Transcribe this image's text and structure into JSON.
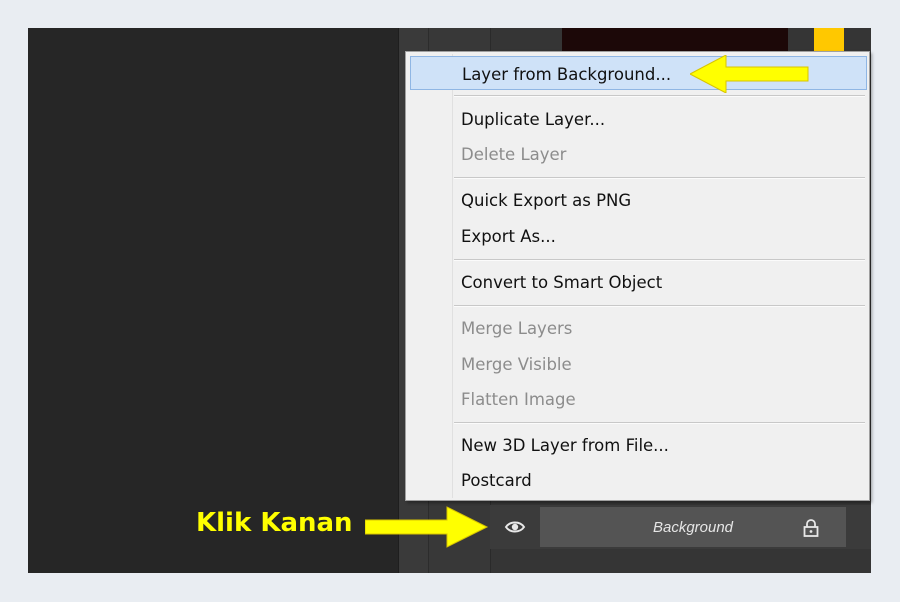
{
  "context_menu": {
    "items": [
      {
        "label": "Layer from Background...",
        "enabled": true,
        "highlighted": true
      },
      {
        "label": "Duplicate Layer...",
        "enabled": true
      },
      {
        "label": "Delete Layer",
        "enabled": false
      },
      {
        "label": "Quick Export as PNG",
        "enabled": true
      },
      {
        "label": "Export As...",
        "enabled": true
      },
      {
        "label": "Convert to Smart Object",
        "enabled": true
      },
      {
        "label": "Merge Layers",
        "enabled": false
      },
      {
        "label": "Merge Visible",
        "enabled": false
      },
      {
        "label": "Flatten Image",
        "enabled": false
      },
      {
        "label": "New 3D Layer from File...",
        "enabled": true
      },
      {
        "label": "Postcard",
        "enabled": true
      }
    ]
  },
  "layers_panel": {
    "layer_name": "Background",
    "visibility_icon": "eye-icon",
    "lock_icon": "lock-icon"
  },
  "annotation": {
    "caption": "Klik Kanan",
    "arrow_color": "#ffff00"
  },
  "colors": {
    "highlight": "#cfe2f8",
    "menu_background": "#f0f0f0",
    "disabled_text": "#8c8c8c",
    "swatch": "#ffc800"
  }
}
